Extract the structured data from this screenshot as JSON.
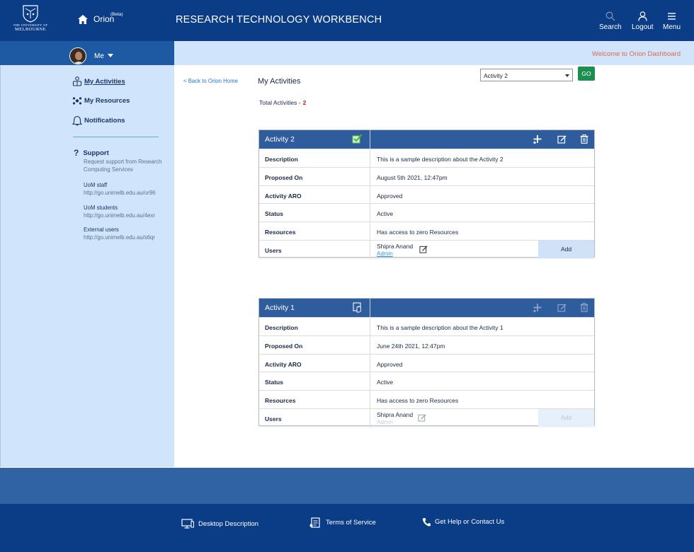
{
  "header": {
    "logo_line1": "THE UNIVERSITY OF",
    "logo_line2": "MELBOURNE",
    "home_label": "Orion",
    "beta_label": "(Beta)",
    "app_title": "RESEARCH TECHNOLOGY WORKBENCH",
    "search_label": "Search",
    "logout_label": "Logout",
    "menu_label": "Menu"
  },
  "userbar": {
    "user_label": "Me",
    "welcome": "Welcome to Orion Dashboard"
  },
  "sidebar": {
    "items": [
      {
        "label": "My  Activities",
        "icon": "activities-icon",
        "active": true
      },
      {
        "label": "My Resources",
        "icon": "resources-icon",
        "active": false
      },
      {
        "label": "Notifications",
        "icon": "bell-icon",
        "active": false
      }
    ],
    "support": {
      "title": "Support",
      "description": "Request support from Research Computing Services",
      "links": [
        {
          "title": "UoM staff",
          "url": "http://go.unimelb.edu.au/or96"
        },
        {
          "title": "UoM students",
          "url": "http://go.unimelb.edu.au/4exr"
        },
        {
          "title": "External users",
          "url": "http://go.unimelb.edu.au/s6qr"
        }
      ]
    }
  },
  "main": {
    "back_link": "< Back to Orion Home",
    "page_title": "My Activities",
    "activity_select": {
      "value": "Activity 2",
      "options": [
        "Activity 2"
      ]
    },
    "go_label": "GO",
    "total_label": "Total Activities  -",
    "total_value": "2",
    "activities": [
      {
        "title": "Activity 2",
        "status_icon": "check-icon",
        "editable": true,
        "rows": [
          {
            "k": "Description",
            "v": "This is a sample description about the Activity 2"
          },
          {
            "k": "Proposed On",
            "v": "August 5th 2021, 12:47pm"
          },
          {
            "k": "Activity ARO",
            "v": "Approved"
          },
          {
            "k": "Status",
            "v": "Active"
          },
          {
            "k": "Resources",
            "v": "Has access to zero Resources"
          }
        ],
        "users_label": "Users",
        "user_name": "Shipra Anand",
        "user_role": "Admin",
        "add_label": "Add"
      },
      {
        "title": "Activity 1",
        "status_icon": "pending-icon",
        "editable": false,
        "rows": [
          {
            "k": "Description",
            "v": "This is a sample description about the Activity 1"
          },
          {
            "k": "Proposed On",
            "v": "June 24th 2021, 12:47pm"
          },
          {
            "k": "Activity ARO",
            "v": "Approved"
          },
          {
            "k": "Status",
            "v": "Active"
          },
          {
            "k": "Resources",
            "v": "Has access to zero Resources"
          }
        ],
        "users_label": "Users",
        "user_name": "Shipra Anand",
        "user_role": "Admin",
        "add_label": "Add"
      }
    ]
  },
  "footer": {
    "links": [
      {
        "label": "Desktop Description",
        "icon": "desktop-icon"
      },
      {
        "label": "Terms of Service",
        "icon": "terms-icon"
      },
      {
        "label": "Get Help or Contact Us",
        "icon": "phone-icon"
      }
    ]
  },
  "colors": {
    "header": "#0b3c86",
    "sidebar": "#d0e4fb",
    "card_header": "#2e5c9c",
    "go": "#1c8e4f",
    "welcome": "#e2694a",
    "accent_red": "#d11b1b"
  }
}
